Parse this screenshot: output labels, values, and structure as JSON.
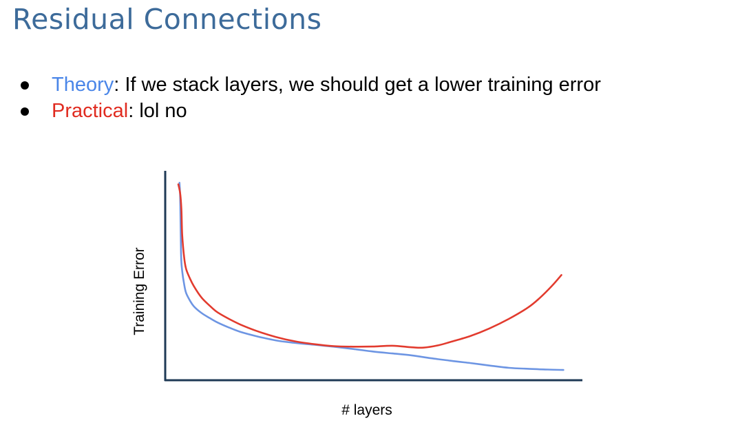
{
  "slide": {
    "title": "Residual Connections"
  },
  "bullets": [
    {
      "highlight": "Theory",
      "color": "#4a86e8",
      "rest": ": If we stack layers, we should get a lower training error"
    },
    {
      "highlight": "Practical",
      "color": "#e02b20",
      "rest": ": lol no"
    }
  ],
  "chart_data": {
    "type": "line",
    "title": "",
    "xlabel": "# layers",
    "ylabel": "Training Error",
    "ticks": "none",
    "series": [
      {
        "color": "#6d95e3",
        "x": [
          0.003,
          0.005,
          0.007,
          0.01,
          0.015,
          0.02,
          0.03,
          0.04,
          0.06,
          0.08,
          0.1,
          0.13,
          0.16,
          0.2,
          0.25,
          0.3,
          0.35,
          0.4,
          0.45,
          0.5,
          0.55,
          0.6,
          0.65,
          0.7,
          0.75,
          0.8,
          0.85,
          0.9,
          0.95,
          0.99
        ],
        "y": [
          0.988,
          0.9,
          0.62,
          0.53,
          0.46,
          0.415,
          0.375,
          0.345,
          0.31,
          0.285,
          0.262,
          0.235,
          0.212,
          0.19,
          0.168,
          0.155,
          0.145,
          0.135,
          0.123,
          0.11,
          0.1,
          0.09,
          0.075,
          0.062,
          0.05,
          0.037,
          0.025,
          0.02,
          0.016,
          0.014
        ]
      },
      {
        "color": "#e23b2e",
        "x": [
          0.0,
          0.005,
          0.008,
          0.01,
          0.015,
          0.02,
          0.03,
          0.04,
          0.06,
          0.08,
          0.1,
          0.13,
          0.16,
          0.2,
          0.25,
          0.3,
          0.35,
          0.4,
          0.45,
          0.5,
          0.55,
          0.6,
          0.63,
          0.67,
          0.7,
          0.75,
          0.8,
          0.85,
          0.9,
          0.93,
          0.96,
          0.985
        ],
        "y": [
          0.98,
          0.93,
          0.85,
          0.72,
          0.6,
          0.54,
          0.49,
          0.45,
          0.39,
          0.35,
          0.315,
          0.28,
          0.25,
          0.218,
          0.186,
          0.163,
          0.148,
          0.138,
          0.135,
          0.136,
          0.14,
          0.132,
          0.13,
          0.143,
          0.16,
          0.19,
          0.23,
          0.28,
          0.34,
          0.39,
          0.45,
          0.508
        ]
      }
    ],
    "xlim": [
      0,
      1
    ],
    "ylim": [
      0,
      1
    ],
    "grid": false,
    "legend": "none"
  }
}
